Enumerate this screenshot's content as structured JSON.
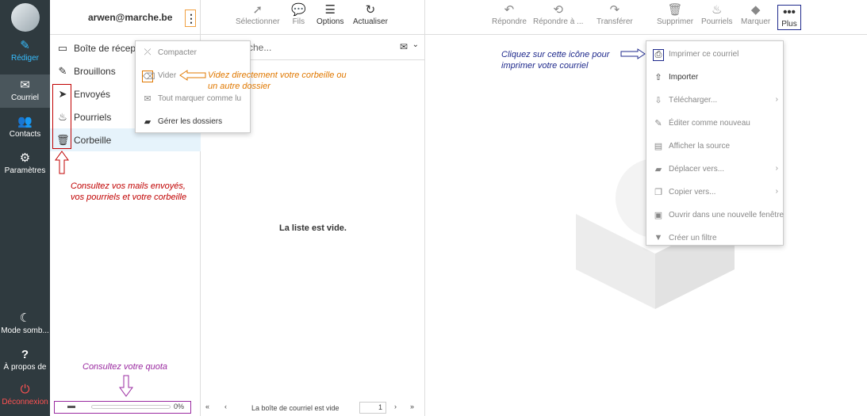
{
  "nav": {
    "compose": "Rédiger",
    "mail": "Courriel",
    "contacts": "Contacts",
    "settings": "Paramètres",
    "dark_mode": "Mode somb...",
    "about": "À propos de",
    "logout": "Déconnexion"
  },
  "account": {
    "email": "arwen@marche.be",
    "menu_icon": "⋮"
  },
  "folders": [
    {
      "label": "Boîte de récept",
      "icon": "inbox-icon"
    },
    {
      "label": "Brouillons",
      "icon": "pencil-icon"
    },
    {
      "label": "Envoyés",
      "icon": "paper-plane-icon"
    },
    {
      "label": "Pourriels",
      "icon": "flame-icon"
    },
    {
      "label": "Corbeille",
      "icon": "trash-icon"
    }
  ],
  "folder_menu": {
    "compact": "Compacter",
    "empty": "Vider",
    "mark_all_read": "Tout marquer comme lu",
    "manage": "Gérer les dossiers"
  },
  "list_toolbar": {
    "select": "Sélectionner",
    "threads": "Fils",
    "options": "Options",
    "refresh": "Actualiser"
  },
  "search_placeholder": "che...",
  "list_empty": "La liste est vide.",
  "list_footer": {
    "status": "La boîte de courriel est vide",
    "page": "1"
  },
  "quota": {
    "percent": "0%",
    "value": 0
  },
  "pane_toolbar": {
    "reply": "Répondre",
    "reply_all": "Répondre à ...",
    "forward": "Transférer",
    "delete": "Supprimer",
    "junk": "Pourriels",
    "mark": "Marquer",
    "more": "Plus"
  },
  "more_menu": {
    "print": "Imprimer ce courriel",
    "import": "Importer",
    "download": "Télécharger...",
    "edit_new": "Éditer comme nouveau",
    "source": "Afficher la source",
    "move": "Déplacer vers...",
    "copy": "Copier vers...",
    "open_new": "Ouvrir dans une nouvelle fenêtre",
    "filter": "Créer un filtre"
  },
  "annotations": {
    "folders": "Consultez vos mails envoyés, vos pourriels et votre corbeille",
    "empty_trash": "Videz directement votre corbeille ou un autre dossier",
    "print": "Cliquez sur cette icône pour imprimer votre courriel",
    "quota": "Consultez votre quota"
  },
  "colors": {
    "nav_bg": "#2f3a3f",
    "accent": "#37beff",
    "annot_red": "#c00000",
    "annot_orange": "#e07800",
    "annot_navy": "#1f2a8c",
    "annot_purple": "#9a2aa0"
  }
}
